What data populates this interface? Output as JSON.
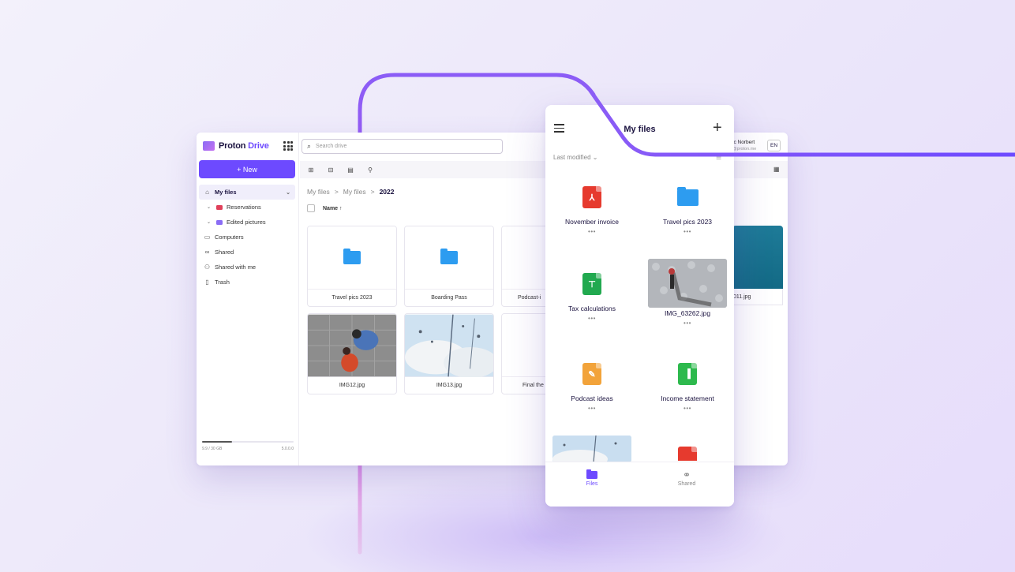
{
  "brand": {
    "name_part1": "Proton",
    "name_part2": "Drive"
  },
  "sidebar": {
    "new_label": "+ New",
    "items": [
      {
        "label": "My files"
      },
      {
        "label": "Reservations"
      },
      {
        "label": "Edited pictures"
      },
      {
        "label": "Computers"
      },
      {
        "label": "Shared"
      },
      {
        "label": "Shared with me"
      },
      {
        "label": "Trash"
      }
    ],
    "storage": {
      "used": "9.9 / 30 GB",
      "version": "5.0.0.0",
      "fill_fraction": 0.33
    }
  },
  "search": {
    "placeholder": "Search drive"
  },
  "breadcrumb": {
    "root": "My files",
    "mid": "My files",
    "current": "2022",
    "sep": ">"
  },
  "table": {
    "name_header": "Name ↑"
  },
  "desktop_files": [
    {
      "name": "Travel pics 2023"
    },
    {
      "name": "Boarding Pass"
    },
    {
      "name": "Podcast-i"
    },
    {
      "name": "IMG12.jpg"
    },
    {
      "name": "IMG13.jpg"
    },
    {
      "name": "Final the"
    }
  ],
  "user": {
    "name": "ic Norbert",
    "email": "@proton.me",
    "lang": "EN"
  },
  "edge_file": {
    "name": "011.jpg"
  },
  "mobile": {
    "title": "My files",
    "sort": "Last modified ⌄",
    "items": [
      {
        "name": "November invoice",
        "more": "•••"
      },
      {
        "name": "Travel pics 2023",
        "more": "•••"
      },
      {
        "name": "Tax calculations",
        "more": "•••"
      },
      {
        "name": "IMG_63262.jpg",
        "more": "•••"
      },
      {
        "name": "Podcast ideas",
        "more": "•••"
      },
      {
        "name": "Income statement",
        "more": "•••"
      }
    ],
    "tabs": {
      "files": "Files",
      "shared": "Shared"
    }
  },
  "colors": {
    "accent": "#6d4aff",
    "folder": "#2d9cf0",
    "pdf": "#e63a2e",
    "sheet": "#21a94f",
    "note": "#f2a33a",
    "chart": "#2db94d"
  }
}
